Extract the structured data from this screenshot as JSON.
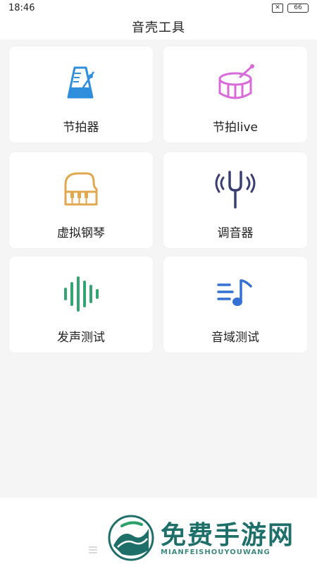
{
  "status_bar": {
    "time": "18:46",
    "sim_icon": "sim-off-icon",
    "battery_level": "66"
  },
  "header": {
    "title": "音壳工具"
  },
  "tools": [
    {
      "label": "节拍器",
      "icon": "metronome-icon",
      "color": "#2f8fdc"
    },
    {
      "label": "节拍live",
      "icon": "drum-icon",
      "color": "#d86ad9"
    },
    {
      "label": "虚拟钢琴",
      "icon": "piano-icon",
      "color": "#e0a84f"
    },
    {
      "label": "调音器",
      "icon": "tuning-fork-icon",
      "color": "#3b3f6f"
    },
    {
      "label": "发声测试",
      "icon": "sound-wave-icon",
      "color": "#34a473"
    },
    {
      "label": "音域测试",
      "icon": "music-note-list-icon",
      "color": "#3570d4"
    }
  ],
  "watermark": {
    "title": "免费手游网",
    "subtitle": "MIANFEISHOUYOUWANG"
  }
}
